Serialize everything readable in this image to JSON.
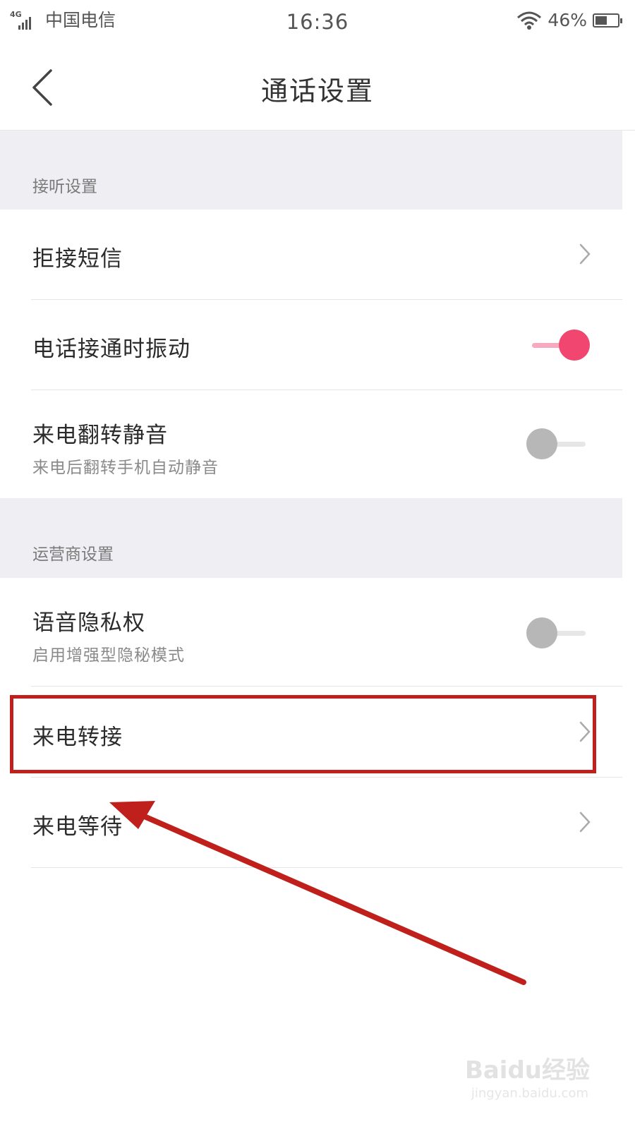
{
  "status_bar": {
    "network": "4G",
    "carrier": "中国电信",
    "time": "16:36",
    "battery_percent": "46%",
    "battery_level": 0.46,
    "icons": [
      "signal-icon",
      "wifi-icon",
      "battery-icon"
    ]
  },
  "header": {
    "title": "通话设置",
    "back_icon": "chevron-left-icon"
  },
  "sections": {
    "answer": {
      "header": "接听设置",
      "items": [
        {
          "label": "拒接短信",
          "control": "chevron"
        },
        {
          "label": "电话接通时振动",
          "control": "toggle",
          "on": true
        },
        {
          "label": "来电翻转静音",
          "sublabel": "来电后翻转手机自动静音",
          "control": "toggle",
          "on": false
        }
      ]
    },
    "carrier": {
      "header": "运营商设置",
      "items": [
        {
          "label": "语音隐私权",
          "sublabel": "启用增强型隐秘模式",
          "control": "toggle",
          "on": false
        },
        {
          "label": "来电转接",
          "control": "chevron"
        },
        {
          "label": "来电等待",
          "control": "chevron"
        }
      ]
    }
  },
  "colors": {
    "accent": "#f0466f",
    "accent_track": "#f7a9c0",
    "toggle_off": "#b7b7b7",
    "section_bg": "#efeff3",
    "annotation": "#c0201c"
  },
  "watermark": {
    "brand": "Baidu经验",
    "url": "jingyan.baidu.com"
  }
}
